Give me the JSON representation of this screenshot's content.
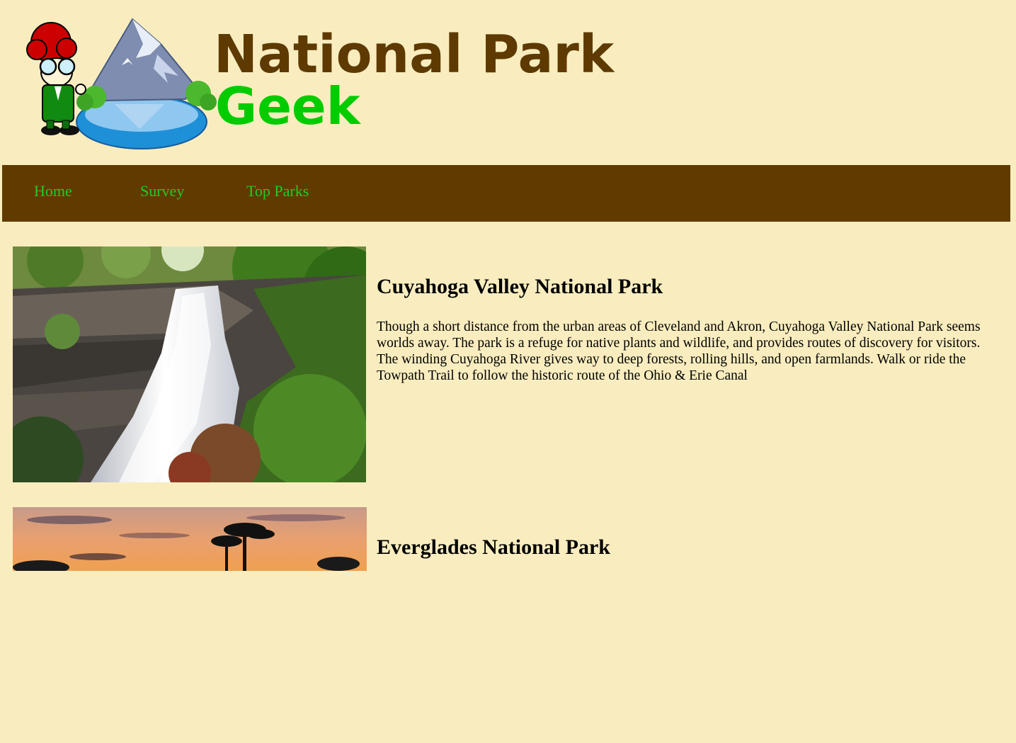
{
  "site": {
    "logo_line1": "National Park",
    "logo_line2": "Geek"
  },
  "nav": {
    "items": [
      {
        "label": "Home"
      },
      {
        "label": "Survey"
      },
      {
        "label": "Top Parks"
      }
    ]
  },
  "parks": [
    {
      "title": "Cuyahoga Valley National Park",
      "description": "Though a short distance from the urban areas of Cleveland and Akron, Cuyahoga Valley National Park seems worlds away. The park is a refuge for native plants and wildlife, and provides routes of discovery for visitors. The winding Cuyahoga River gives way to deep forests, rolling hills, and open farmlands. Walk or ride the Towpath Trail to follow the historic route of the Ohio & Erie Canal"
    },
    {
      "title": "Everglades National Park",
      "description": ""
    }
  ],
  "colors": {
    "background": "#f9edbf",
    "nav_background": "#613a00",
    "nav_link": "#22cc22",
    "logo_brown": "#5e3a00",
    "logo_green": "#00cc00"
  }
}
